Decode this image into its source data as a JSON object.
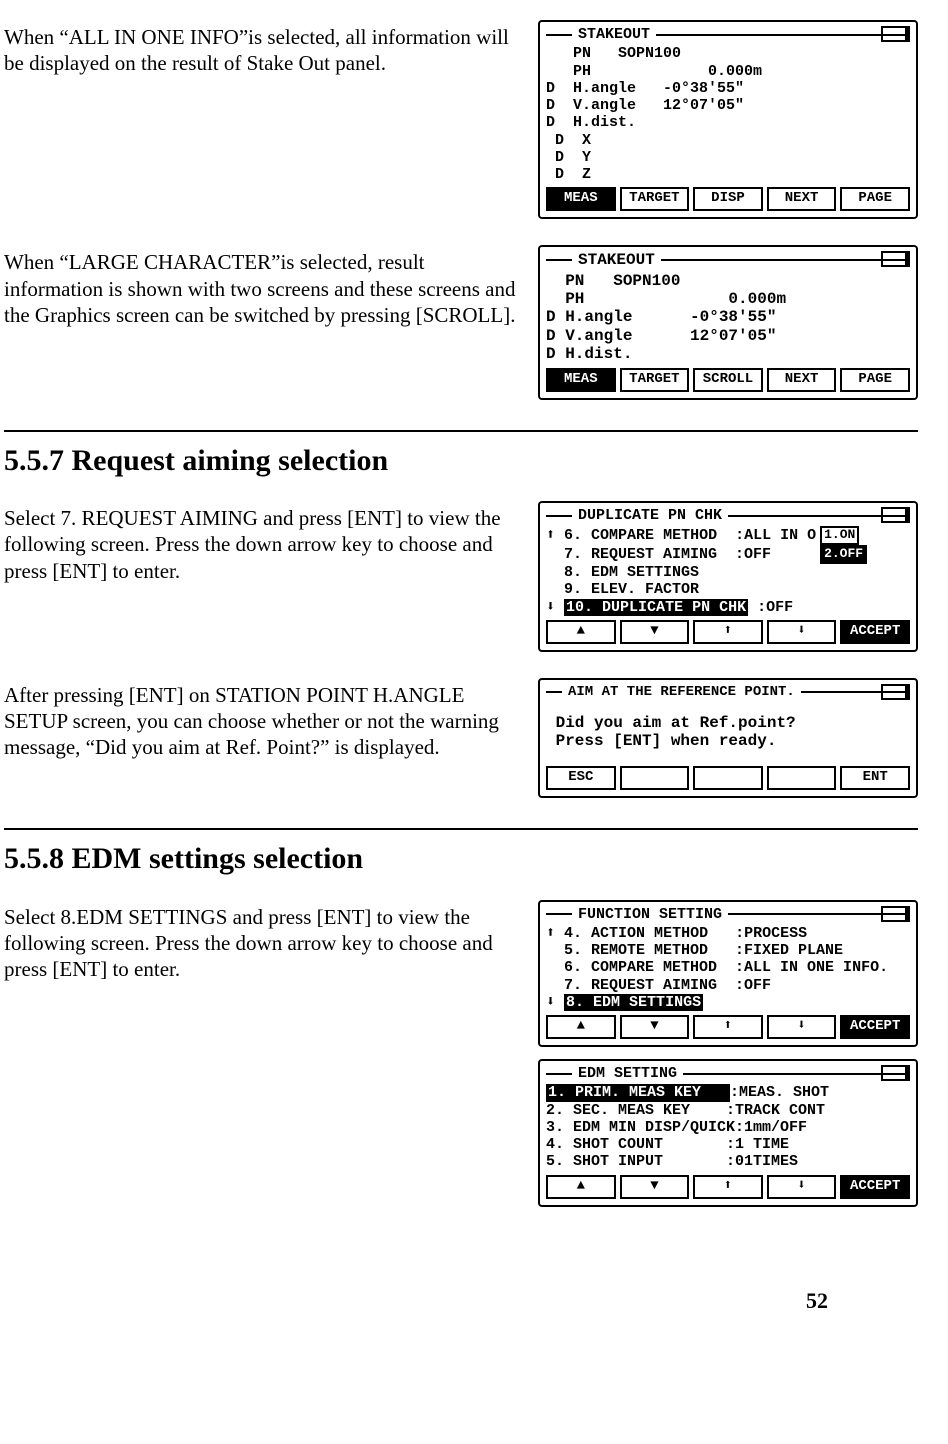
{
  "para1": "When “ALL IN ONE INFO”is selected, all information will be displayed on the result of Stake Out panel.",
  "para2": "When “LARGE CHARACTER”is selected, result information is shown with two screens and these screens and the Graphics screen can be switched by pressing [SCROLL].",
  "sec557_heading": "5.5.7 Request aiming selection",
  "sec557_p1": "Select 7. REQUEST AIMING and press [ENT] to view the following screen. Press the down arrow key to choose and press [ENT] to enter.",
  "sec557_p2": "After pressing [ENT] on STATION POINT H.ANGLE SETUP screen, you can choose whether or not the warning message, “Did you aim at Ref. Point?” is displayed.",
  "sec558_heading": "5.5.8 EDM settings selection",
  "sec558_p1": "Select 8.EDM SETTINGS and press [ENT] to view the following screen. Press the down arrow key to choose and press [ENT] to enter.",
  "page_number": "52",
  "lcd_stakeout_all": {
    "title": "STAKEOUT",
    "lines": [
      "   PN   SOPN100",
      "   PH             0.000m",
      "D  H.angle   -0°38'55\"",
      "D  V.angle   12°07'05\"",
      "D  H.dist.",
      " D  X",
      " D  Y",
      " D  Z"
    ],
    "softkeys": [
      "MEAS",
      "TARGET",
      "DISP",
      "NEXT",
      "PAGE"
    ]
  },
  "lcd_stakeout_large": {
    "title": "STAKEOUT",
    "lines": [
      "  PN   SOPN100",
      "  PH               0.000m",
      "D H.angle      -0°38'55\"",
      "D V.angle      12°07'05\"",
      "D H.dist."
    ],
    "softkeys": [
      "MEAS",
      "TARGET",
      "SCROLL",
      "NEXT",
      "PAGE"
    ]
  },
  "lcd_duplicate": {
    "title": "DUPLICATE PN CHK",
    "lines": [
      {
        "pre": "⬆ ",
        "text": "6. COMPARE METHOD  :ALL IN O",
        "pill": "1.ON"
      },
      {
        "pre": "  ",
        "text": "7. REQUEST AIMING  :OFF     ",
        "pill": "2.OFF",
        "pill_inv": true
      },
      {
        "pre": "  ",
        "text": "8. EDM SETTINGS"
      },
      {
        "pre": "  ",
        "text": "9. ELEV. FACTOR"
      },
      {
        "pre": "⬇ ",
        "inv": "10. DUPLICATE PN CHK",
        "tail": " :OFF"
      }
    ],
    "softkeys": [
      "▲",
      "▼",
      "⬆",
      "⬇",
      "ACCEPT"
    ]
  },
  "lcd_aimref": {
    "title": "AIM AT THE REFERENCE POINT.",
    "body1": " Did you aim at Ref.point?",
    "body2": " Press [ENT] when ready.",
    "softkeys": [
      "ESC",
      "",
      "",
      "",
      "ENT"
    ]
  },
  "lcd_function": {
    "title": "FUNCTION SETTING",
    "lines": [
      {
        "pre": "⬆ ",
        "text": "4. ACTION METHOD   :PROCESS"
      },
      {
        "pre": "  ",
        "text": "5. REMOTE METHOD   :FIXED PLANE"
      },
      {
        "pre": "  ",
        "text": "6. COMPARE METHOD  :ALL IN ONE INFO."
      },
      {
        "pre": "  ",
        "text": "7. REQUEST AIMING  :OFF"
      },
      {
        "pre": "⬇ ",
        "inv": "8. EDM SETTINGS"
      }
    ],
    "softkeys": [
      "▲",
      "▼",
      "⬆",
      "⬇",
      "ACCEPT"
    ]
  },
  "lcd_edm": {
    "title": "EDM SETTING",
    "lines": [
      {
        "inv": "1. PRIM. MEAS KEY   ",
        "tail": ":MEAS. SHOT"
      },
      {
        "text": "2. SEC. MEAS KEY    :TRACK CONT"
      },
      {
        "text": "3. EDM MIN DISP/QUICK:1mm/OFF"
      },
      {
        "text": "4. SHOT COUNT       :1 TIME"
      },
      {
        "text": "5. SHOT INPUT       :01TIMES"
      }
    ],
    "softkeys": [
      "▲",
      "▼",
      "⬆",
      "⬇",
      "ACCEPT"
    ]
  }
}
